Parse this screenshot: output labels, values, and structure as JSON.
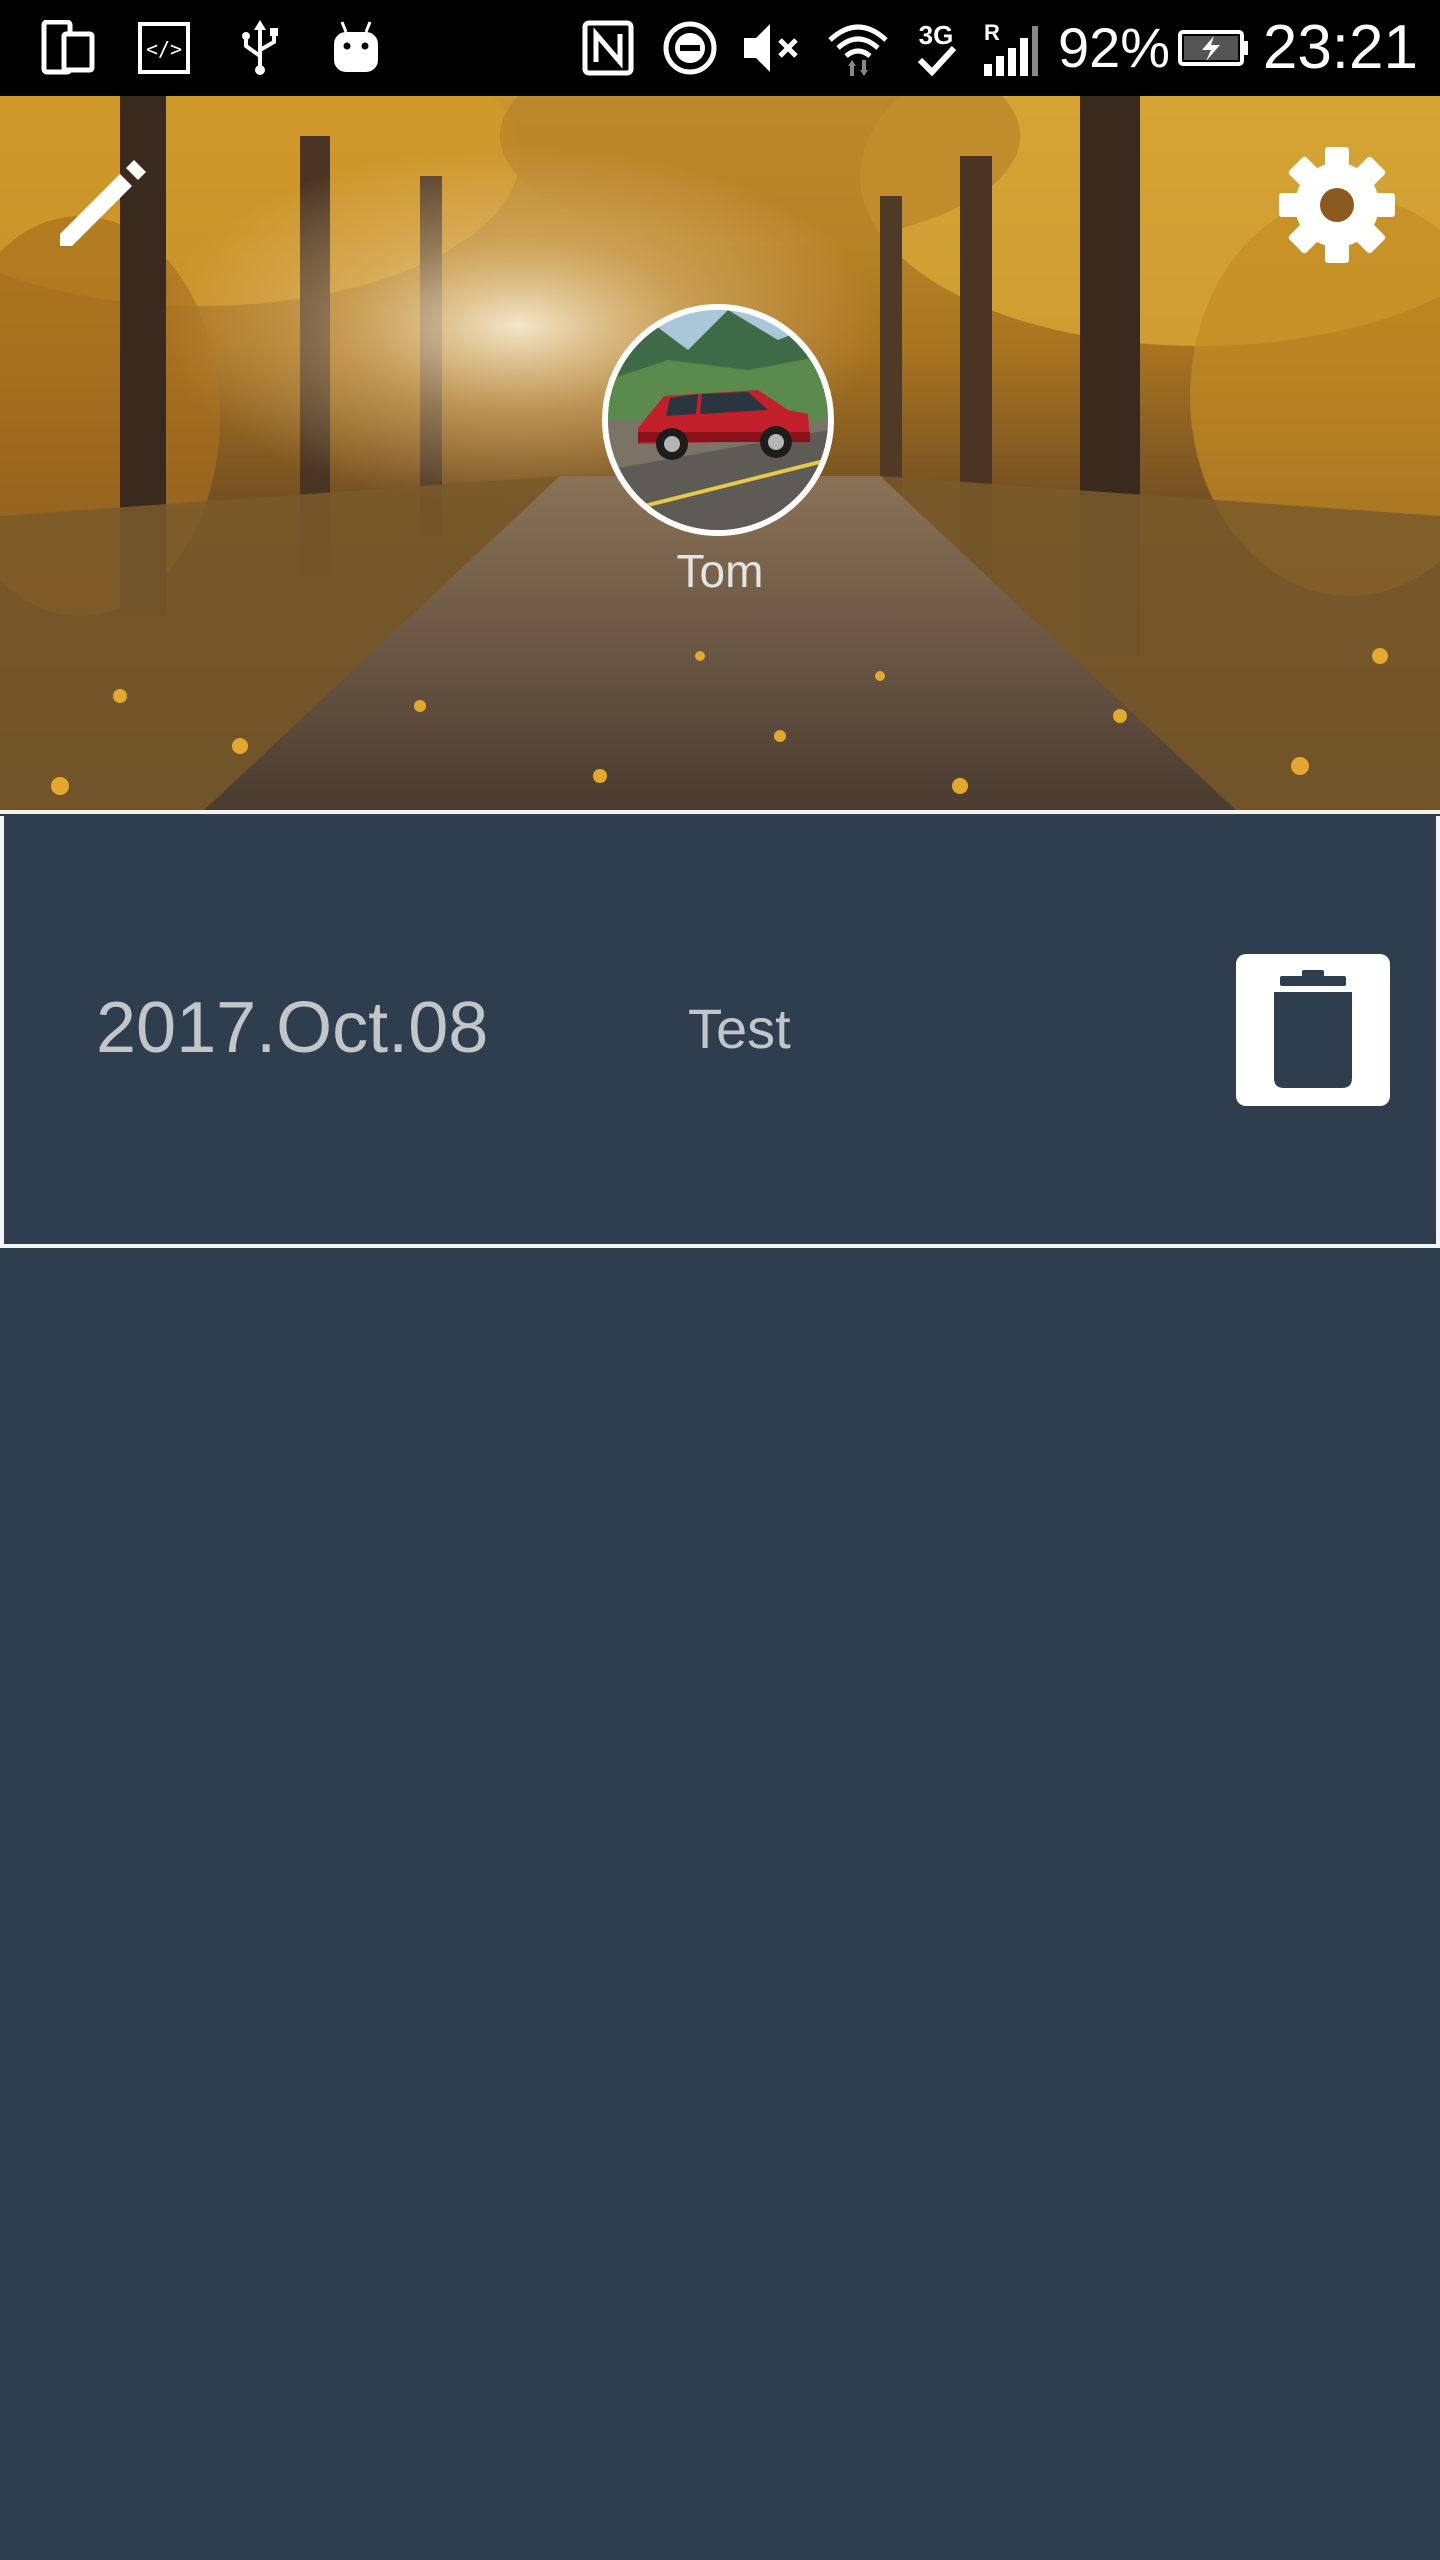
{
  "status_bar": {
    "battery_percent": "92%",
    "time": "23:21",
    "icons": [
      "device-mirror-icon",
      "developer-code-icon",
      "usb-icon",
      "android-debug-icon",
      "nfc-icon",
      "do-not-disturb-icon",
      "volume-muted-icon",
      "wifi-icon",
      "network-3g-icon",
      "signal-roaming-icon",
      "battery-charging-icon"
    ],
    "network_label": "3G",
    "roaming_label": "R"
  },
  "header": {
    "edit_icon": "pencil-icon",
    "settings_icon": "gear-icon",
    "avatar_image": "red-suv-photo",
    "user_name": "Tom"
  },
  "entries": [
    {
      "date": "2017.Oct.08",
      "title": "Test",
      "delete_icon": "trash-icon"
    }
  ],
  "colors": {
    "background": "#2f3e4f",
    "status_bar": "#000000",
    "text_muted": "#c3c6c9",
    "card_border": "#f4f4f4",
    "icon_white": "#ffffff"
  }
}
